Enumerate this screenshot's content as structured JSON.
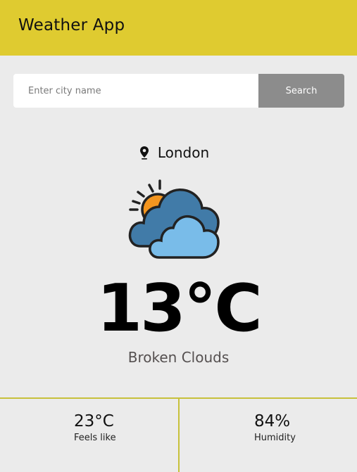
{
  "header": {
    "title": "Weather App",
    "background_color": "#dfcb30"
  },
  "search": {
    "placeholder": "Enter city name",
    "value": "",
    "button_label": "Search"
  },
  "current": {
    "city": "London",
    "location_icon": "map-pin-icon",
    "condition_icon": "sun-behind-clouds-icon",
    "temperature": "13°C",
    "description": "Broken Clouds"
  },
  "stats": {
    "feels_like_value": "23°C",
    "feels_like_label": "Feels like",
    "humidity_value": "84%",
    "humidity_label": "Humidity",
    "divider_color": "#c7c13b"
  }
}
